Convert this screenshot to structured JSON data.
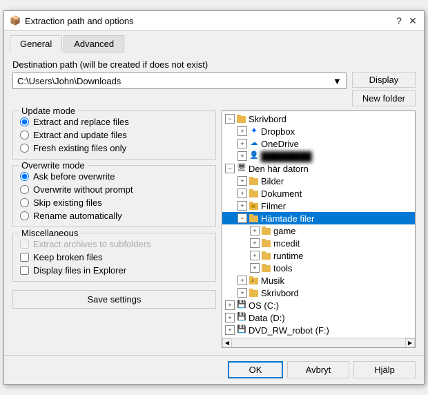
{
  "dialog": {
    "title": "Extraction path and options",
    "icon": "📦"
  },
  "tabs": [
    {
      "id": "general",
      "label": "General",
      "active": true
    },
    {
      "id": "advanced",
      "label": "Advanced",
      "active": false
    }
  ],
  "destination": {
    "label": "Destination path (will be created if does not exist)",
    "path": "C:\\Users\\John\\Downloads",
    "display_btn": "Display",
    "new_folder_btn": "New folder"
  },
  "update_mode": {
    "label": "Update mode",
    "options": [
      {
        "id": "extract_replace",
        "label": "Extract and replace files",
        "checked": true
      },
      {
        "id": "extract_update",
        "label": "Extract and update files",
        "checked": false
      },
      {
        "id": "fresh_existing",
        "label": "Fresh existing files only",
        "checked": false
      }
    ]
  },
  "overwrite_mode": {
    "label": "Overwrite mode",
    "options": [
      {
        "id": "ask_before",
        "label": "Ask before overwrite",
        "checked": true
      },
      {
        "id": "overwrite_no_prompt",
        "label": "Overwrite without prompt",
        "checked": false
      },
      {
        "id": "skip_existing",
        "label": "Skip existing files",
        "checked": false
      },
      {
        "id": "rename_auto",
        "label": "Rename automatically",
        "checked": false
      }
    ]
  },
  "miscellaneous": {
    "label": "Miscellaneous",
    "options": [
      {
        "id": "extract_subfolders",
        "label": "Extract archives to subfolders",
        "checked": false,
        "disabled": true
      },
      {
        "id": "keep_broken",
        "label": "Keep broken files",
        "checked": false
      },
      {
        "id": "display_explorer",
        "label": "Display files in Explorer",
        "checked": false
      }
    ]
  },
  "save_btn": "Save settings",
  "tree": {
    "items": [
      {
        "id": "skrivbord",
        "label": "Skrivbord",
        "level": 0,
        "expand": true,
        "icon": "folder",
        "selected": false
      },
      {
        "id": "dropbox",
        "label": "Dropbox",
        "level": 1,
        "expand": false,
        "icon": "dropbox",
        "selected": false
      },
      {
        "id": "onedrive",
        "label": "OneDrive",
        "level": 1,
        "expand": false,
        "icon": "onedrive",
        "selected": false
      },
      {
        "id": "blurred",
        "label": "████████",
        "level": 1,
        "expand": false,
        "icon": "person",
        "selected": false,
        "blurred": true
      },
      {
        "id": "den_har_datorn",
        "label": "Den här datorn",
        "level": 0,
        "expand": true,
        "icon": "computer",
        "selected": false
      },
      {
        "id": "bilder",
        "label": "Bilder",
        "level": 1,
        "expand": false,
        "icon": "folder",
        "selected": false
      },
      {
        "id": "dokument",
        "label": "Dokument",
        "level": 1,
        "expand": false,
        "icon": "folder",
        "selected": false
      },
      {
        "id": "filmer",
        "label": "Filmer",
        "level": 1,
        "expand": false,
        "icon": "folder-special",
        "selected": false
      },
      {
        "id": "hamtade_filer",
        "label": "Hämtade filer",
        "level": 1,
        "expand": true,
        "icon": "folder",
        "selected": true
      },
      {
        "id": "game",
        "label": "game",
        "level": 2,
        "expand": false,
        "icon": "folder",
        "selected": false
      },
      {
        "id": "mcedit",
        "label": "mcedit",
        "level": 2,
        "expand": false,
        "icon": "folder",
        "selected": false
      },
      {
        "id": "runtime",
        "label": "runtime",
        "level": 2,
        "expand": false,
        "icon": "folder",
        "selected": false
      },
      {
        "id": "tools",
        "label": "tools",
        "level": 2,
        "expand": false,
        "icon": "folder",
        "selected": false
      },
      {
        "id": "musik",
        "label": "Musik",
        "level": 1,
        "expand": false,
        "icon": "music",
        "selected": false
      },
      {
        "id": "skrivbord2",
        "label": "Skrivbord",
        "level": 1,
        "expand": false,
        "icon": "folder",
        "selected": false
      },
      {
        "id": "os_c",
        "label": "OS (C:)",
        "level": 0,
        "expand": false,
        "icon": "drive",
        "selected": false
      },
      {
        "id": "data_d",
        "label": "Data (D:)",
        "level": 0,
        "expand": false,
        "icon": "drive",
        "selected": false
      },
      {
        "id": "dvd",
        "label": "DVD_RW_robot (F:)",
        "level": 0,
        "expand": false,
        "icon": "drive",
        "selected": false
      }
    ]
  },
  "bottom": {
    "ok": "OK",
    "cancel": "Avbryt",
    "help": "Hjälp"
  }
}
